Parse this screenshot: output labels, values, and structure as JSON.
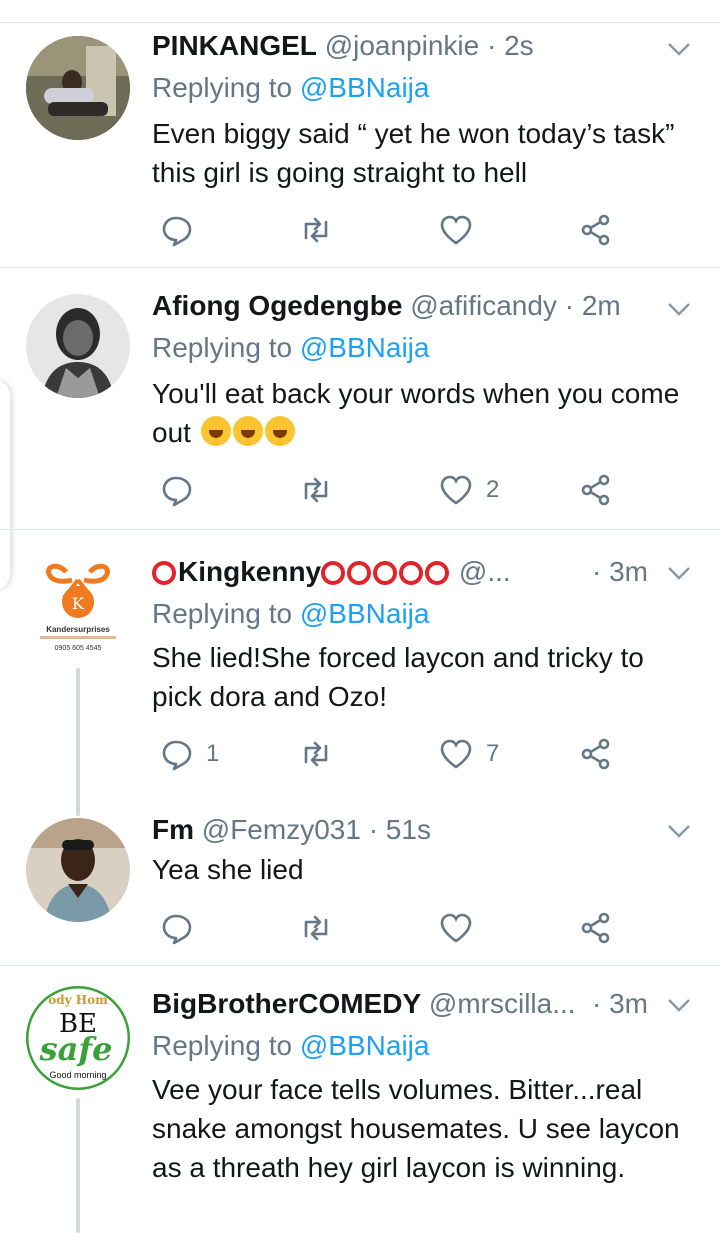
{
  "icons": {
    "reply": "reply-icon",
    "retweet": "retweet-icon",
    "like": "heart-icon",
    "share": "share-icon",
    "menu": "chevron-down-icon"
  },
  "colors": {
    "accent": "#1da1f2",
    "muted": "#657786",
    "divider": "#e1e8ed"
  },
  "tweets": [
    {
      "name": "PINKANGEL",
      "handle": "@joanpinkie",
      "time": "· 2s",
      "replying_prefix": "Replying to ",
      "replying_to": "@BBNaija",
      "text": "Even biggy said “ yet he won today’s task” this girl is going straight to hell",
      "reply_count": "",
      "retweet_count": "",
      "like_count": ""
    },
    {
      "name": "Afiong Ogedengbe",
      "handle": "@afificandy",
      "time": "· 2m",
      "replying_prefix": "Replying to ",
      "replying_to": "@BBNaija",
      "text": "You'll eat back your words when you come out",
      "reply_count": "",
      "retweet_count": "",
      "like_count": "2"
    },
    {
      "name": "Kingkenny",
      "handle": "@...",
      "time": "· 3m",
      "replying_prefix": "Replying to ",
      "replying_to": "@BBNaija",
      "text": "She lied!She forced laycon and tricky to pick dora and Ozo!",
      "reply_count": "1",
      "retweet_count": "",
      "like_count": "7",
      "avatar_text": {
        "brand": "Kandersurprises",
        "phone": "0905 605 4545",
        "letter": "K"
      }
    },
    {
      "name": "Fm",
      "handle": "@Femzy031",
      "time": "· 51s",
      "text": "Yea she lied",
      "reply_count": "",
      "retweet_count": "",
      "like_count": ""
    },
    {
      "name": "BigBrotherCOMEDY",
      "handle": "@mrscilla...",
      "time": "· 3m",
      "replying_prefix": "Replying to ",
      "replying_to": "@BBNaija",
      "text": "Vee your face tells volumes.  Bitter...real snake amongst  housemates. U see laycon as a threath hey girl laycon  is winning.",
      "avatar_text": {
        "top": "ody Hom",
        "be": "BE",
        "safe": "safe",
        "bottom": "Good morning"
      }
    }
  ]
}
